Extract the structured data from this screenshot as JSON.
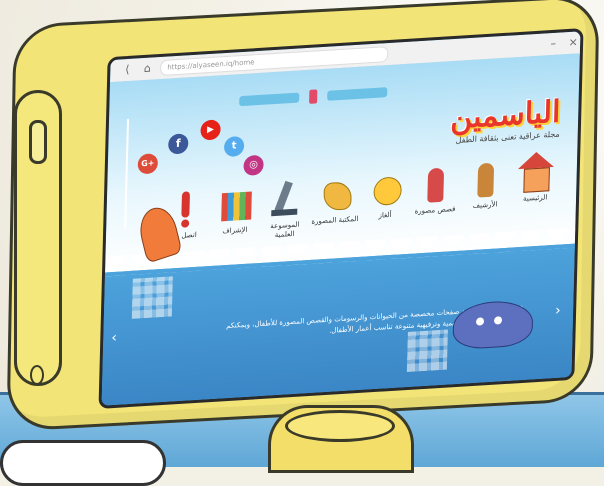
{
  "browser": {
    "url": "https://alyaseen.iq/home",
    "nav_back": "⟨",
    "nav_home": "⌂"
  },
  "brand": {
    "logo_text": "الياسمين",
    "tagline": "مجلة عراقية تعنى بثقافة الطفل"
  },
  "menu": [
    {
      "label": "الرئيسية",
      "icon": "house-icon"
    },
    {
      "label": "الأرشيف",
      "icon": "figures-icon"
    },
    {
      "label": "قصص مصورة",
      "icon": "characters-icon"
    },
    {
      "label": "ألغاز",
      "icon": "chick-icon"
    },
    {
      "label": "المكتبة المصورة",
      "icon": "bird-icon"
    },
    {
      "label": "الموسوعة العلمية",
      "icon": "microscope-icon"
    },
    {
      "label": "الإشراف",
      "icon": "books-icon"
    },
    {
      "label": "اتصل بنا",
      "icon": "exclaim-icon"
    }
  ],
  "social": {
    "google": "G+",
    "facebook": "f",
    "youtube": "▶",
    "twitter": "t",
    "instagram": "◎"
  },
  "body_text": "في مجلة ياسمين تجد صفحات مخصصة من الحيوانات والرسومات والقصص المصورة للأطفال، ويمكنكم التعرف على مواضيع تعليمية وترفيهية متنوعة تناسب أعمار الأطفال.",
  "colors": {
    "monitor": "#f2e476",
    "screen_sky": "#a8dcf5",
    "screen_sea": "#4da3dc",
    "brand_red": "#e8362d"
  }
}
